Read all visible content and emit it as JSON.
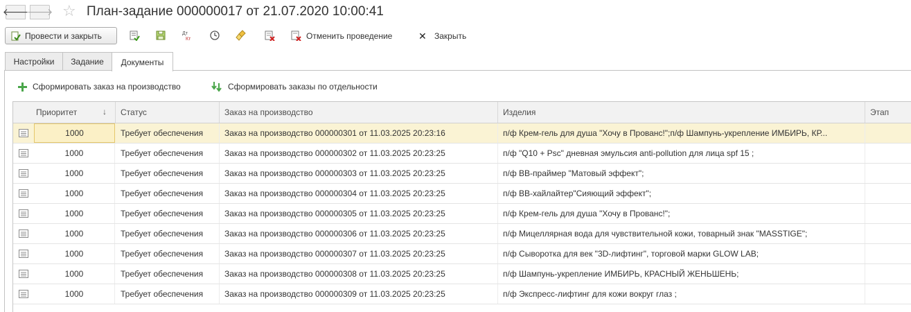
{
  "window": {
    "title": "План-задание 000000017 от 21.07.2020 10:00:41",
    "nav_back": "🡐",
    "nav_forward": "🡒",
    "favorite_icon": "star-icon"
  },
  "toolbar": {
    "post_and_close": "Провести и закрыть",
    "cancel_posting": "Отменить проведение",
    "close": "Закрыть",
    "close_glyph": "✕",
    "icons": [
      "write-icon",
      "save-icon",
      "dt-kt-icon",
      "history-icon",
      "broom-icon",
      "delete-mark-icon",
      "cancel-posting-icon"
    ],
    "dtkt_top": "Дт",
    "dtkt_bottom": "Кт"
  },
  "tabs": [
    {
      "label": "Настройки",
      "active": false
    },
    {
      "label": "Задание",
      "active": false
    },
    {
      "label": "Документы",
      "active": true
    }
  ],
  "commands": {
    "create_order": "Сформировать заказ на производство",
    "create_orders_separately": "Сформировать заказы по отдельности"
  },
  "table": {
    "columns": {
      "priority": "Приоритет",
      "sort_indicator": "↓",
      "status": "Статус",
      "order": "Заказ на производство",
      "products": "Изделия",
      "stage": "Этап"
    },
    "rows": [
      {
        "priority": "1000",
        "status": "Требует обеспечения",
        "order": "Заказ на производство 000000301 от 11.03.2025 20:23:16",
        "products": "п/ф Крем-гель для душа \"Хочу в Прованс!\";п/ф Шампунь-укрепление ИМБИРЬ, КР...",
        "stage": "",
        "selected": true
      },
      {
        "priority": "1000",
        "status": "Требует обеспечения",
        "order": "Заказ на производство 000000302 от 11.03.2025 20:23:25",
        "products": "п/ф \"Q10 + Psc\" дневная эмульсия anti-pollution для лица spf 15 ;",
        "stage": ""
      },
      {
        "priority": "1000",
        "status": "Требует обеспечения",
        "order": "Заказ на производство 000000303 от 11.03.2025 20:23:25",
        "products": "п/ф ВВ-праймер \"Матовый эффект\";",
        "stage": ""
      },
      {
        "priority": "1000",
        "status": "Требует обеспечения",
        "order": "Заказ на производство 000000304 от 11.03.2025 20:23:25",
        "products": "п/ф ВВ-хайлайтер\"Сияющий эффект\";",
        "stage": ""
      },
      {
        "priority": "1000",
        "status": "Требует обеспечения",
        "order": "Заказ на производство 000000305 от 11.03.2025 20:23:25",
        "products": "п/ф Крем-гель для душа \"Хочу в Прованс!\";",
        "stage": ""
      },
      {
        "priority": "1000",
        "status": "Требует обеспечения",
        "order": "Заказ на производство 000000306 от 11.03.2025 20:23:25",
        "products": "п/ф Мицеллярная вода для чувствительной кожи, товарный знак \"MASSTIGE\";",
        "stage": ""
      },
      {
        "priority": "1000",
        "status": "Требует обеспечения",
        "order": "Заказ на производство 000000307 от 11.03.2025 20:23:25",
        "products": "п/ф Сыворотка для век \"3D-лифтинг\", торговой марки GLOW LAB;",
        "stage": ""
      },
      {
        "priority": "1000",
        "status": "Требует обеспечения",
        "order": "Заказ на производство 000000308 от 11.03.2025 20:23:25",
        "products": "п/ф Шампунь-укрепление ИМБИРЬ, КРАСНЫЙ ЖЕНЬШЕНЬ;",
        "stage": ""
      },
      {
        "priority": "1000",
        "status": "Требует обеспечения",
        "order": "Заказ на производство 000000309 от 11.03.2025 20:23:25",
        "products": "п/ф Экспресс-лифтинг для кожи вокруг глаз ;",
        "stage": ""
      }
    ]
  },
  "colors": {
    "selected_row": "#faf3d4",
    "header_bg": "#f2f2f2",
    "accent_green": "#4aa64a"
  }
}
